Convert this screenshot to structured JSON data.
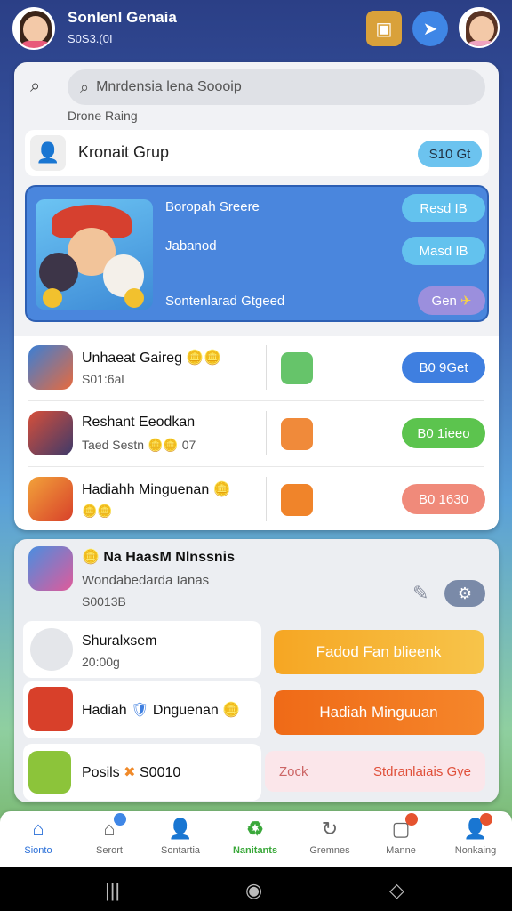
{
  "header": {
    "title": "Sonlenl Genaia",
    "subtitle": "S0S3.(0I",
    "icons": [
      "treasure-chest-icon",
      "send-icon",
      "profile-icon"
    ]
  },
  "search": {
    "placeholder": "Mnrdensia lena Soooip"
  },
  "section_label": "Drone Raing",
  "group": {
    "label": "Kronait Grup",
    "button": "S10 Gt"
  },
  "feature": {
    "line1": "Boropah Sreere",
    "line2": "Jabanod",
    "line3": "Sontenlarad Gtgeed",
    "btn1": "Resd IB",
    "btn2": "Masd IB",
    "btn3": "Gen"
  },
  "list": [
    {
      "title": "Unhaeat Gaireg",
      "sub": "S01:6al",
      "button": "B0 9Get",
      "btn_color": "#3f7fe0"
    },
    {
      "title": "Reshant Eeodkan",
      "sub": "Taed Sestn",
      "sub_suffix": "07",
      "button": "B0 1ieeo",
      "btn_color": "#5cc44e"
    },
    {
      "title": "Hadiahh Minguenan",
      "sub": "",
      "button": "B0 1630",
      "btn_color": "#f08a7a"
    }
  ],
  "panel2": {
    "title": "Na HaasM Nlnssnis",
    "sub1": "Wondabedarda Ianas",
    "sub2": "S0013B",
    "rows": [
      {
        "title": "Shuralxsem",
        "sub": "20:00g"
      },
      {
        "title": "Hadiah",
        "title2": "Dnguenan",
        "sub": ""
      },
      {
        "title": "Posils",
        "sub": "S0010"
      }
    ],
    "btn1": "Fadod Fan blieenk",
    "btn2": "Hadiah Minguuan",
    "btn3_left": "Zock",
    "btn3_right": "Stdranlaiais Gye"
  },
  "nav": [
    {
      "label": "Sionto",
      "icon": "home-icon",
      "active": true
    },
    {
      "label": "Serort",
      "icon": "store-icon",
      "badge": ""
    },
    {
      "label": "Sontartia",
      "icon": "person-icon"
    },
    {
      "label": "Nanitants",
      "icon": "recycle-icon",
      "green": true
    },
    {
      "label": "Gremnes",
      "icon": "refresh-icon"
    },
    {
      "label": "Manne",
      "icon": "calendar-icon",
      "badge": ""
    },
    {
      "label": "Nonkaing",
      "icon": "user-badge-icon",
      "badge": ""
    }
  ]
}
